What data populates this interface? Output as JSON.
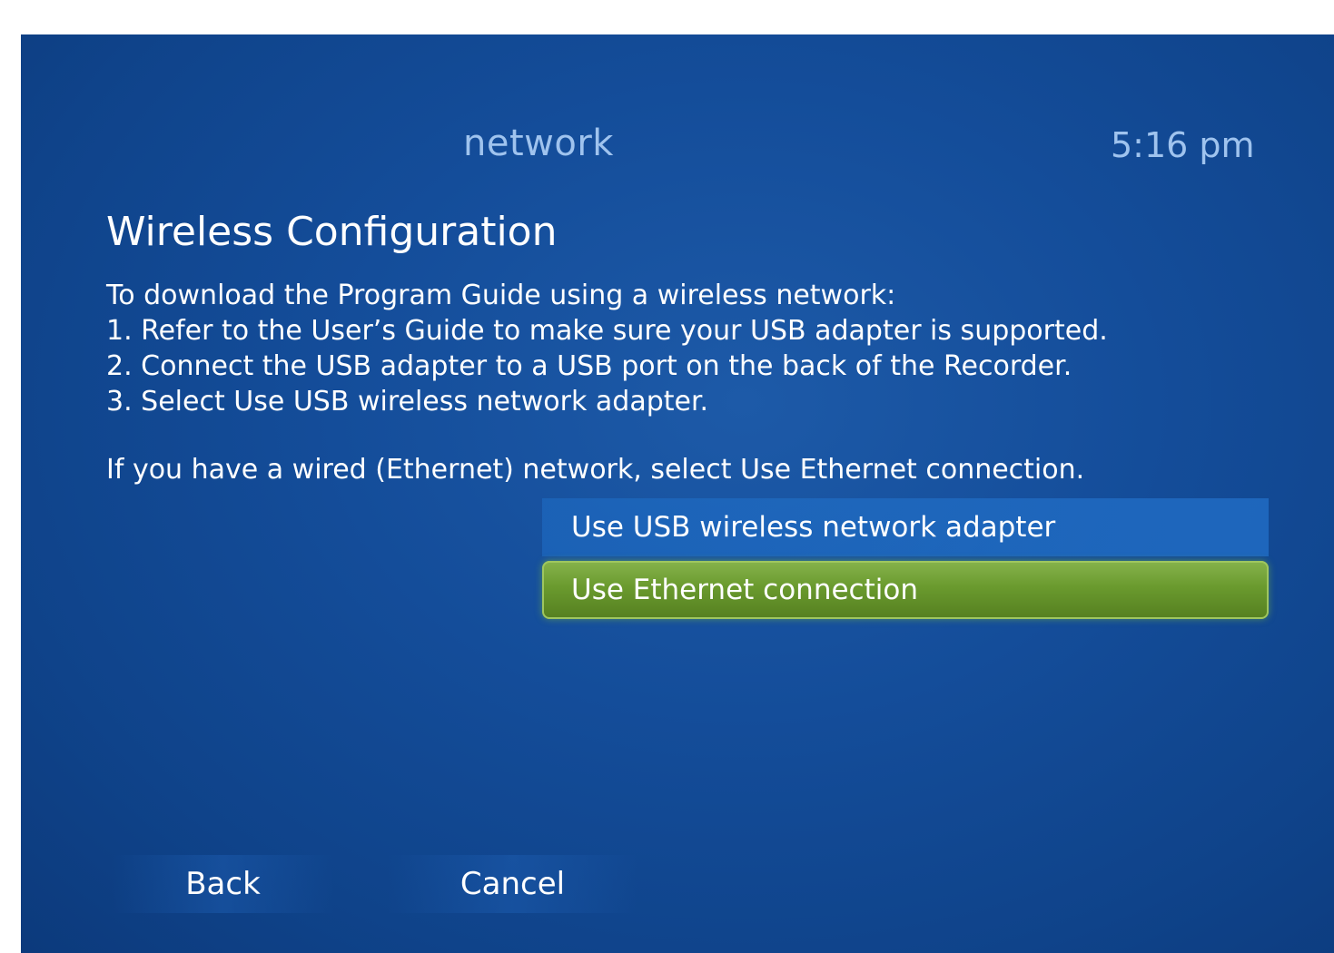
{
  "header": {
    "title": "network",
    "time": "5:16 pm"
  },
  "page": {
    "title": "Wireless Configuration",
    "instructions": [
      "To download the Program Guide using a wireless network:",
      "1. Refer to the User’s Guide to make sure your USB adapter is supported.",
      "2. Connect the USB adapter to a USB port on the back of the Recorder.",
      "3. Select Use USB wireless network adapter."
    ],
    "ethernet_note": "If you have a wired (Ethernet) network, select Use Ethernet connection."
  },
  "options": [
    {
      "label": "Use USB wireless network adapter",
      "selected": false
    },
    {
      "label": "Use Ethernet connection",
      "selected": true
    }
  ],
  "nav": {
    "back_label": "Back",
    "cancel_label": "Cancel"
  },
  "colors": {
    "background": "#144d9a",
    "selected_option": "#6a9a2e",
    "header_text": "#9fc3ee"
  }
}
